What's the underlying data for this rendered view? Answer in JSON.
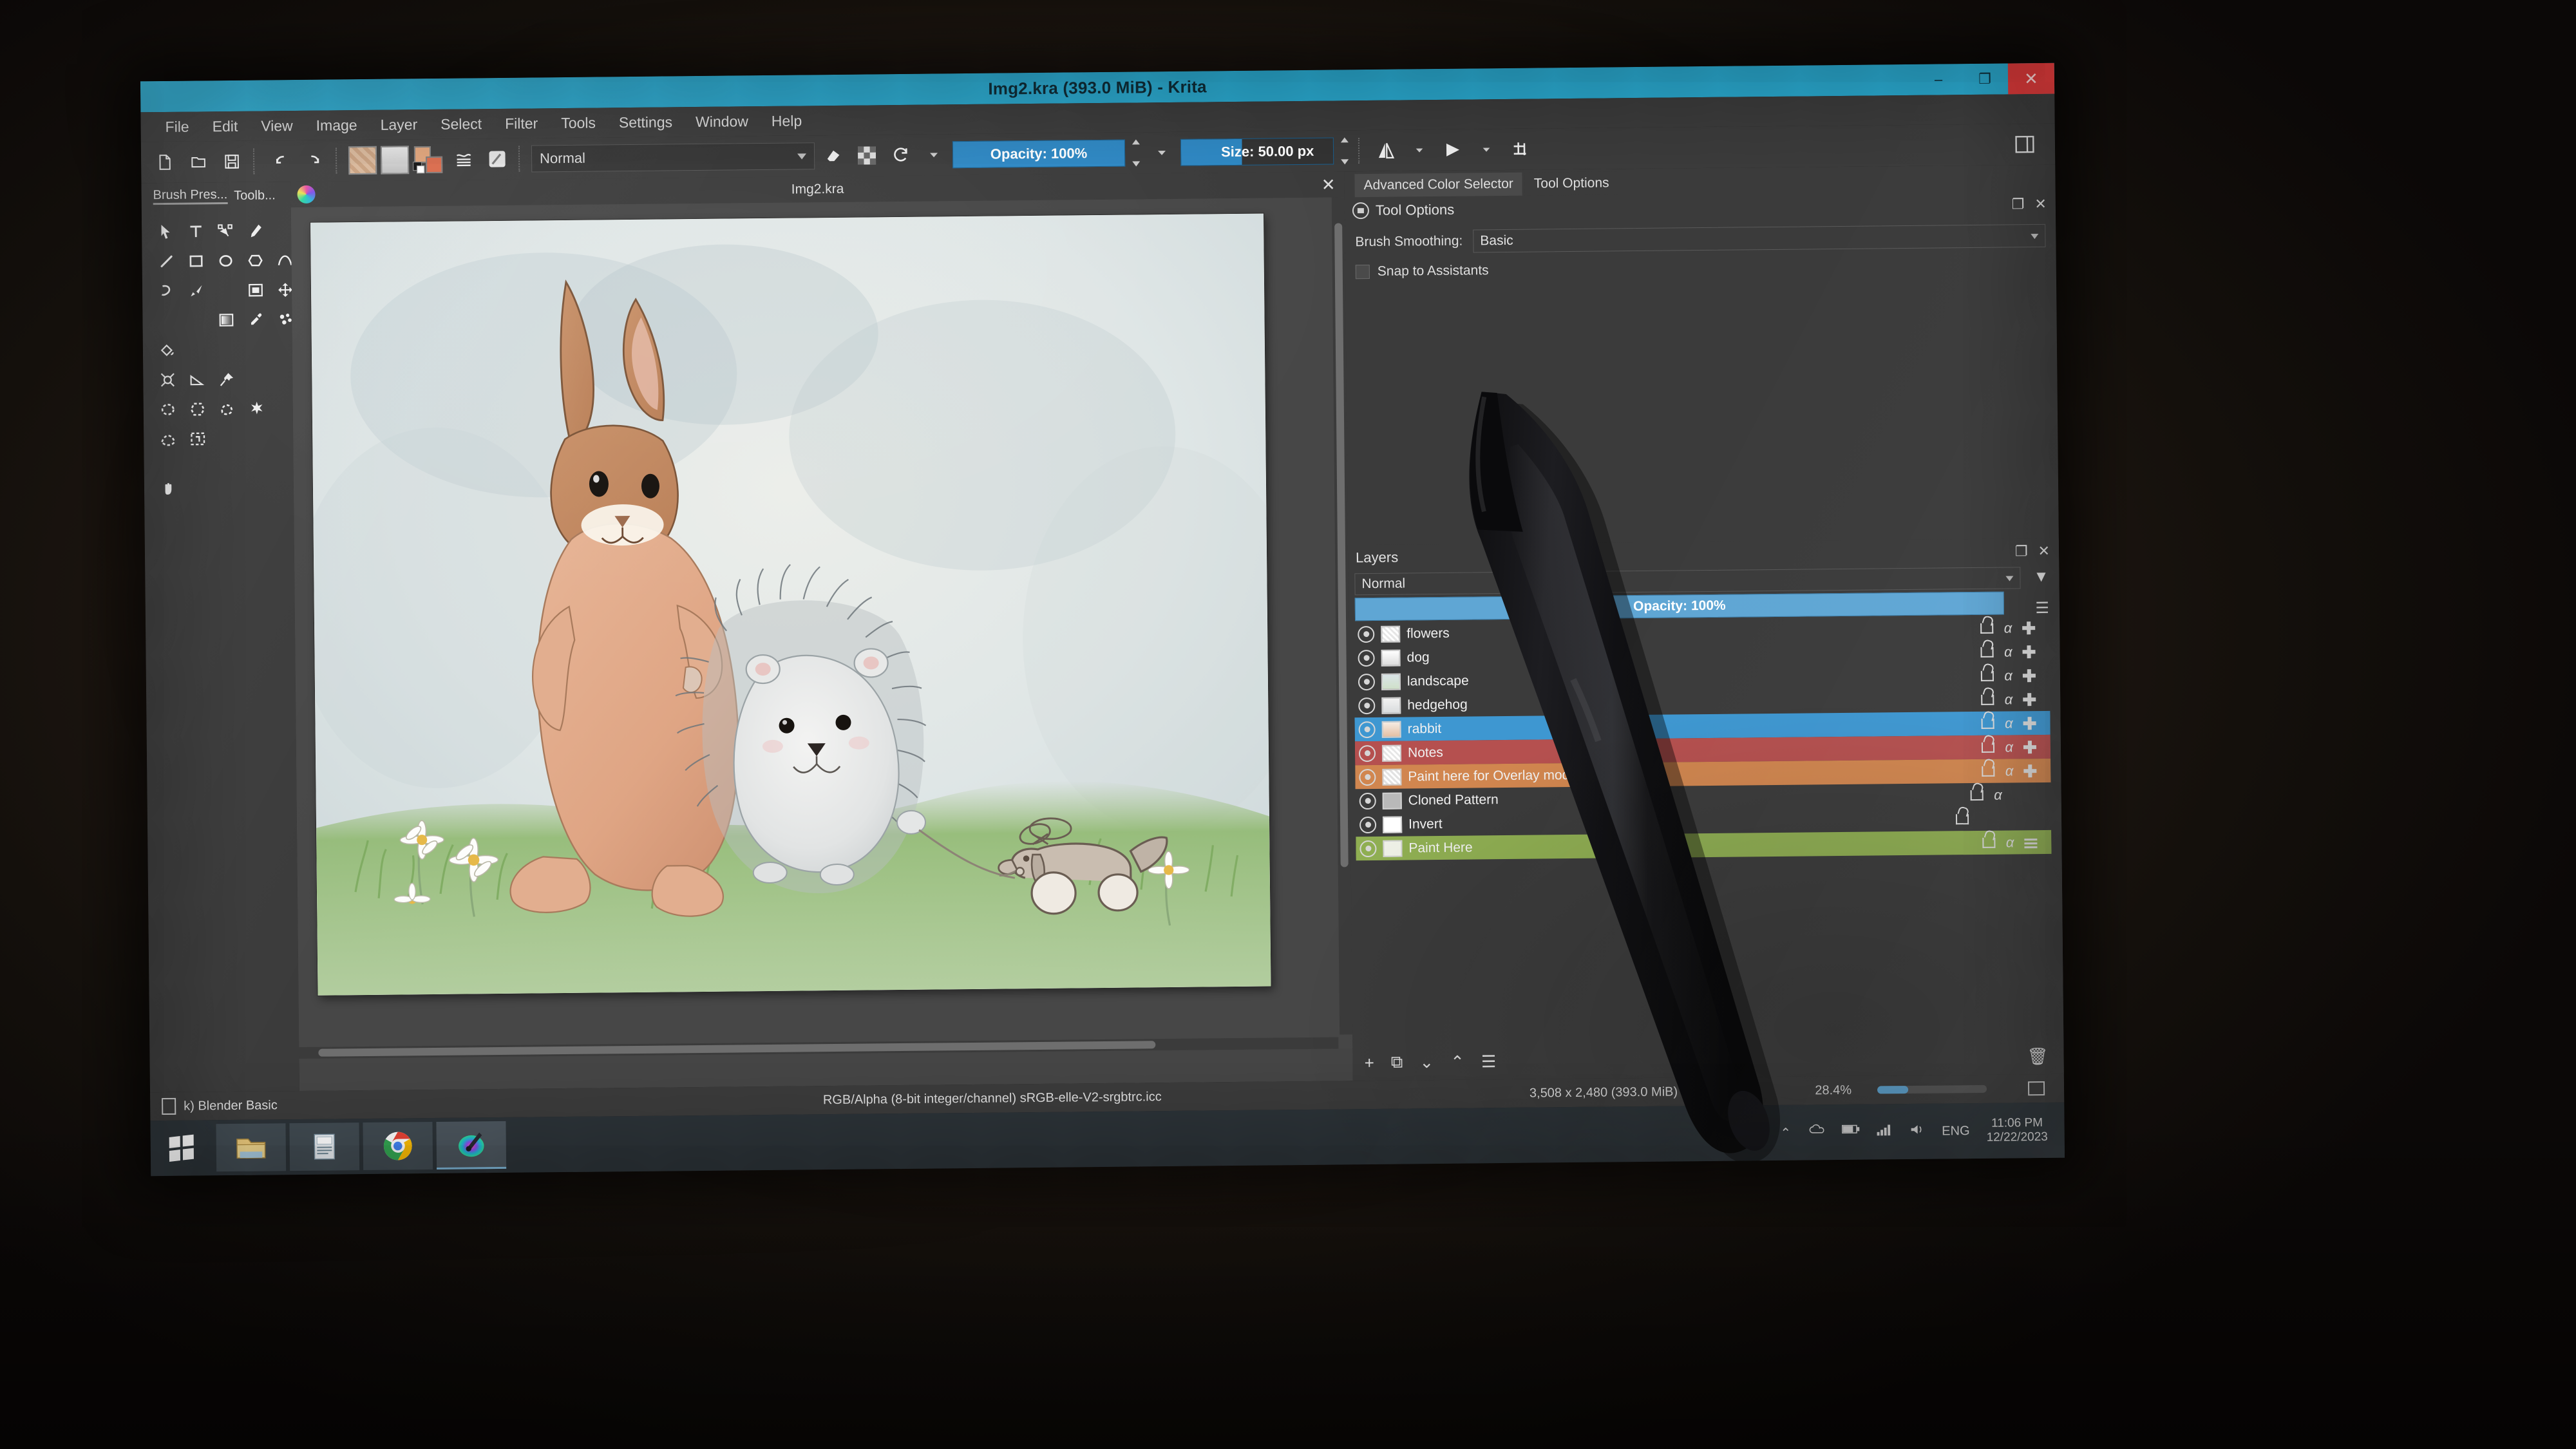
{
  "window": {
    "title": "Img2.kra (393.0 MiB)  - Krita",
    "minimize": "–",
    "restore": "❐",
    "close": "✕"
  },
  "menubar": {
    "items": [
      "File",
      "Edit",
      "View",
      "Image",
      "Layer",
      "Select",
      "Filter",
      "Tools",
      "Settings",
      "Window",
      "Help"
    ]
  },
  "toolbar": {
    "new_icon": "new-file-icon",
    "open_icon": "open-folder-icon",
    "save_icon": "save-disk-icon",
    "undo_icon": "undo-icon",
    "redo_icon": "redo-icon",
    "pattern_icon": "pattern-swatch",
    "gradient_icon": "gradient-swatch",
    "fgbg_icon": "foreground-background-colors",
    "presets_icon": "brush-presets-icon",
    "editbrush_icon": "edit-brush-settings-icon",
    "blend_mode": "Normal",
    "eraser_icon": "eraser-icon",
    "alpha_icon": "preserve-alpha-icon",
    "reload_icon": "reload-preset-icon",
    "opacity_label": "Opacity: 100%",
    "size_label": "Size: 50.00 px",
    "mirror_h_icon": "mirror-horizontal-icon",
    "mirror_v_icon": "mirror-vertical-icon",
    "wrap_icon": "wrap-around-icon",
    "workspace_icon": "workspace-chooser-icon"
  },
  "left_dock": {
    "tabs": [
      {
        "label": "Brush Pres...",
        "active": true
      },
      {
        "label": "Toolb...",
        "active": false
      }
    ],
    "tools": [
      {
        "name": "select-shapes-tool",
        "glyph": "cursor",
        "selected": false
      },
      {
        "name": "text-tool",
        "glyph": "T",
        "selected": false
      },
      {
        "name": "edit-shapes-tool",
        "glyph": "node",
        "selected": false
      },
      {
        "name": "calligraphy-tool",
        "glyph": "calligraphy",
        "selected": false
      },
      {
        "name": "freehand-brush-tool",
        "glyph": "brush",
        "selected": true
      },
      {
        "name": "line-tool",
        "glyph": "line",
        "selected": false
      },
      {
        "name": "rectangle-tool",
        "glyph": "rect",
        "selected": false
      },
      {
        "name": "ellipse-tool",
        "glyph": "ellipse",
        "selected": false
      },
      {
        "name": "polygon-tool",
        "glyph": "polygon",
        "selected": false
      },
      {
        "name": "polyline-tool",
        "glyph": "polyline",
        "selected": false
      },
      {
        "name": "bezier-curve-tool",
        "glyph": "bezier",
        "selected": false
      },
      {
        "name": "freehand-path-tool",
        "glyph": "freehandpath",
        "selected": false
      },
      {
        "name": "dynamic-brush-tool",
        "glyph": "dynbrush",
        "selected": false
      },
      {
        "name": "multibrush-tool",
        "glyph": "multibrush",
        "selected": false
      },
      {
        "name": "transform-tool",
        "glyph": "transform",
        "selected": false
      },
      {
        "name": "move-tool",
        "glyph": "move",
        "selected": false
      },
      {
        "name": "crop-tool",
        "glyph": "crop",
        "selected": false
      },
      {
        "name": "gradient-tool",
        "glyph": "gradient",
        "selected": false
      },
      {
        "name": "color-sampler-tool",
        "glyph": "dropper",
        "selected": false
      },
      {
        "name": "colorize-mask-tool",
        "glyph": "colorize",
        "selected": false
      },
      {
        "name": "smart-patch-tool",
        "glyph": "patch",
        "selected": false
      },
      {
        "name": "fill-tool",
        "glyph": "fill",
        "selected": false
      },
      {
        "name": "enclose-fill-tool",
        "glyph": "enclose",
        "selected": false
      },
      {
        "name": "assistant-tool",
        "glyph": "assistant",
        "selected": false
      },
      {
        "name": "measure-tool",
        "glyph": "measure",
        "selected": false
      },
      {
        "name": "reference-images-tool",
        "glyph": "reference",
        "selected": false
      },
      {
        "name": "rectangular-select-tool",
        "glyph": "selrect",
        "selected": false
      },
      {
        "name": "elliptical-select-tool",
        "glyph": "selellipse",
        "selected": false
      },
      {
        "name": "polygonal-select-tool",
        "glyph": "selpoly",
        "selected": false
      },
      {
        "name": "freehand-select-tool",
        "glyph": "sellasso",
        "selected": false
      },
      {
        "name": "contiguous-select-tool",
        "glyph": "selmagic",
        "selected": false
      },
      {
        "name": "similar-color-select-tool",
        "glyph": "selsimilar",
        "selected": false
      },
      {
        "name": "bezier-select-tool",
        "glyph": "selbezier",
        "selected": false
      },
      {
        "name": "magnetic-select-tool",
        "glyph": "selmagnetic",
        "selected": false
      },
      {
        "name": "zoom-tool",
        "glyph": "zoom",
        "selected": false
      },
      {
        "name": "pan-tool",
        "glyph": "pan",
        "selected": false
      }
    ]
  },
  "canvas": {
    "tab_title": "Img2.kra",
    "close_label": "✕",
    "artwork_description": "Watercolour illustration of a standing brown rabbit beside a grey hedgehog on grass, with daisies and a small wooden pull-along toy dog on wheels"
  },
  "right_dock": {
    "tabs": [
      {
        "label": "Advanced Color Selector",
        "active": false
      },
      {
        "label": "Tool Options",
        "active": true
      }
    ],
    "tool_options": {
      "panel_title": "Tool Options",
      "brush_smoothing_label": "Brush Smoothing:",
      "brush_smoothing_value": "Basic",
      "snap_to_assistants_label": "Snap to Assistants",
      "float_icon": "float-panel-icon",
      "close_icon": "close-panel-icon"
    }
  },
  "layers_panel": {
    "title": "Layers",
    "float_icon": "float-panel-icon",
    "close_icon": "close-panel-icon",
    "filter_icon": "filter-funnel-icon",
    "menu_icon": "hamburger-menu-icon",
    "blend_mode": "Normal",
    "opacity_label": "Opacity:  100%",
    "layers": [
      {
        "name": "flowers",
        "color": "none",
        "selected": false,
        "visible": true,
        "badges": [
          "lock",
          "alpha",
          "grid"
        ]
      },
      {
        "name": "dog",
        "color": "none",
        "selected": false,
        "visible": true,
        "badges": [
          "lock",
          "alpha",
          "grid"
        ]
      },
      {
        "name": "landscape",
        "color": "none",
        "selected": false,
        "visible": true,
        "badges": [
          "lock",
          "alpha",
          "grid"
        ]
      },
      {
        "name": "hedgehog",
        "color": "none",
        "selected": false,
        "visible": true,
        "badges": [
          "lock",
          "alpha",
          "grid"
        ]
      },
      {
        "name": "rabbit",
        "color": "#3e97d1",
        "selected": true,
        "visible": true,
        "badges": [
          "lock",
          "alpha",
          "grid"
        ]
      },
      {
        "name": "Notes",
        "color": "#b5504f",
        "selected": false,
        "visible": true,
        "badges": [
          "lock",
          "alpha",
          "grid"
        ]
      },
      {
        "name": "Paint here for Overlay mode",
        "color": "#d1864f",
        "selected": false,
        "visible": true,
        "badges": [
          "lock",
          "alpha",
          "grid"
        ]
      },
      {
        "name": "Cloned Pattern",
        "color": "none",
        "selected": false,
        "visible": true,
        "badges": [
          "lock",
          "alpha"
        ]
      },
      {
        "name": "Invert",
        "color": "none",
        "selected": false,
        "visible": true,
        "badges": [
          "lock"
        ]
      },
      {
        "name": "Paint Here",
        "color": "#8fae52",
        "selected": false,
        "visible": true,
        "badges": [
          "lock",
          "alpha",
          "grid"
        ]
      }
    ],
    "footer": {
      "add_icon": "add-layer-icon",
      "duplicate_icon": "duplicate-layer-icon",
      "down_icon": "move-layer-down-icon",
      "up_icon": "move-layer-up-icon",
      "properties_icon": "layer-properties-icon",
      "delete_icon": "delete-layer-icon"
    }
  },
  "statusbar": {
    "brush_preset": "k) Blender Basic",
    "color_space": "RGB/Alpha (8-bit integer/channel)  sRGB-elle-V2-srgbtrc.icc",
    "dimensions": "3,508 x 2,480 (393.0 MiB)",
    "zoom": "28.4%",
    "selection_icon": "selection-mask-icon",
    "fit_icon": "fit-to-screen-icon"
  },
  "taskbar": {
    "start_icon": "windows-start-icon",
    "apps": [
      {
        "name": "file-explorer-icon",
        "active": false
      },
      {
        "name": "sticky-notes-icon",
        "active": false
      },
      {
        "name": "google-chrome-icon",
        "active": false
      },
      {
        "name": "krita-icon",
        "active": true
      }
    ],
    "tray": {
      "arrow_icon": "show-hidden-icons-icon",
      "keyboard_icon": "touch-keyboard-icon",
      "onedrive_icon": "onedrive-icon",
      "battery_icon": "battery-icon",
      "network_icon": "network-icon",
      "volume_icon": "volume-icon",
      "language": "ENG",
      "time": "11:06 PM",
      "date": "12/22/2023"
    }
  },
  "overlay": {
    "stylus": "stylus-pen-resting-on-screen"
  },
  "colors": {
    "titlebar": "#2aa9cf",
    "chrome": "#3b3b3b",
    "accent_blue": "#3e97d1",
    "close_red": "#e03a3a",
    "layer_red": "#b5504f",
    "layer_orange": "#d1864f",
    "layer_green": "#8fae52"
  }
}
